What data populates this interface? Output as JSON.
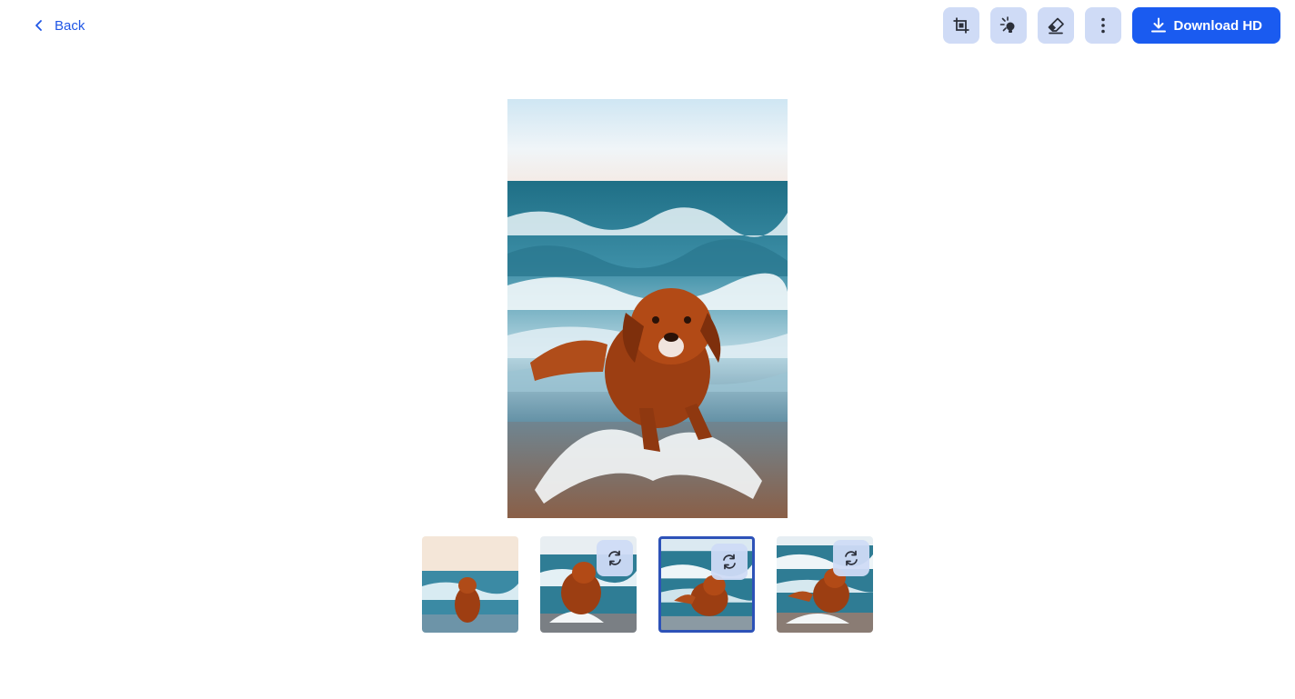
{
  "header": {
    "back_label": "Back",
    "download_label": "Download HD"
  },
  "toolbar": {
    "buttons": [
      {
        "name": "crop-icon"
      },
      {
        "name": "magic-light-icon"
      },
      {
        "name": "eraser-icon"
      },
      {
        "name": "more-vertical-icon"
      }
    ]
  },
  "thumbnails": [
    {
      "name": "thumbnail-1",
      "selected": false,
      "has_regenerate": false
    },
    {
      "name": "thumbnail-2",
      "selected": false,
      "has_regenerate": true
    },
    {
      "name": "thumbnail-3",
      "selected": true,
      "has_regenerate": true
    },
    {
      "name": "thumbnail-4",
      "selected": false,
      "has_regenerate": true
    }
  ],
  "colors": {
    "accent": "#1a5bf0",
    "tool_button_bg": "#cfdbf6",
    "selected_border": "#2d52b8"
  }
}
